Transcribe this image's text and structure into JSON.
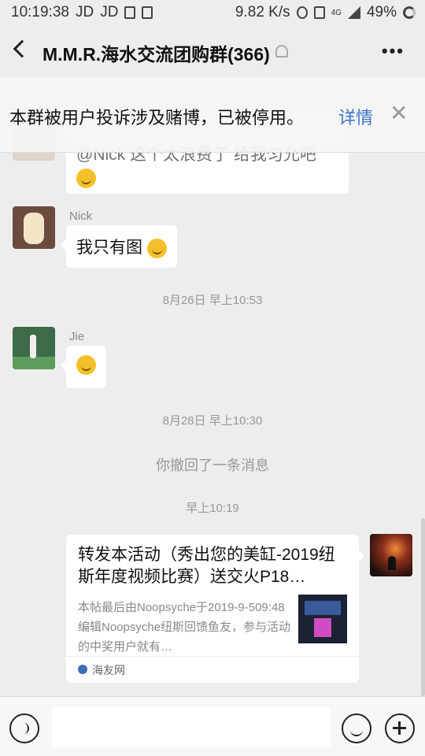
{
  "status_bar": {
    "time": "10:19:38",
    "left_icons": [
      "JD",
      "JD"
    ],
    "net_speed": "9.82 K/s",
    "network": "4G",
    "battery": "49%"
  },
  "header": {
    "back_icon": "chevron-left-icon",
    "title": "M.M.R.海水交流团购群(366)",
    "muted_icon": "bell-off-icon",
    "more_icon": "more-icon"
  },
  "notice": {
    "text": "本群被用户投诉涉及赌博，已被停用。",
    "link": "详情",
    "close": "✕"
  },
  "messages": [
    {
      "sender": "",
      "text": "@Nick 这个太浪费了 给我匀允吧",
      "emoji": "grimace-emoji"
    },
    {
      "sender": "Nick",
      "text": "我只有图",
      "emoji": "thinking-emoji"
    },
    {
      "time": "8月26日 早上10:53"
    },
    {
      "sender": "Jie",
      "text": "",
      "emoji": "smirk-emoji"
    },
    {
      "time": "8月28日 早上10:30"
    },
    {
      "system": "你撤回了一条消息"
    },
    {
      "time": "早上10:19"
    }
  ],
  "share_card": {
    "title": "转发本活动（秀出您的美缸-2019纽斯年度视频比赛）送交火P18…",
    "desc": "本帖最后由Noopsyche于2019-9-509:48编辑Noopsyche纽斯回馈鱼友，参与活动的中奖用户就有…",
    "source": "海友网"
  },
  "colors": {
    "background": "#ededed",
    "link": "#3b74c4",
    "bubble": "#ffffff"
  }
}
